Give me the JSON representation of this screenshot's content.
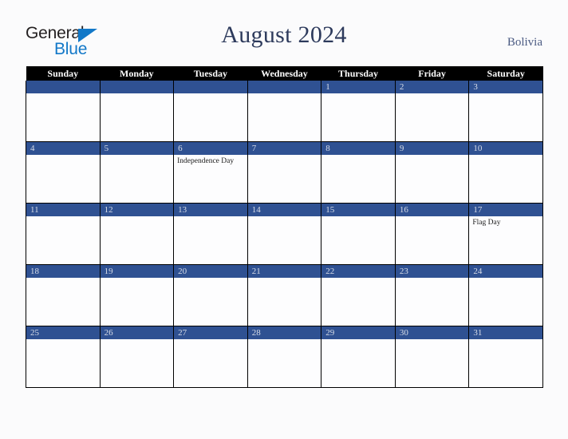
{
  "brand": {
    "name_part1": "General",
    "name_part2": "Blue",
    "triangle_color": "#1278c8",
    "text_color": "#231f20"
  },
  "header": {
    "title": "August 2024",
    "region": "Bolivia",
    "title_color": "#2d3a5c"
  },
  "calendar": {
    "weekday_headers": [
      "Sunday",
      "Monday",
      "Tuesday",
      "Wednesday",
      "Thursday",
      "Friday",
      "Saturday"
    ],
    "header_bg": "#000000",
    "daybar_bg": "#2f5192",
    "daybar_text_color": "#d8dde8",
    "cell_bg": "#fdfdfe",
    "weeks": [
      [
        {
          "date": "",
          "event": ""
        },
        {
          "date": "",
          "event": ""
        },
        {
          "date": "",
          "event": ""
        },
        {
          "date": "",
          "event": ""
        },
        {
          "date": "1",
          "event": ""
        },
        {
          "date": "2",
          "event": ""
        },
        {
          "date": "3",
          "event": ""
        }
      ],
      [
        {
          "date": "4",
          "event": ""
        },
        {
          "date": "5",
          "event": ""
        },
        {
          "date": "6",
          "event": "Independence Day"
        },
        {
          "date": "7",
          "event": ""
        },
        {
          "date": "8",
          "event": ""
        },
        {
          "date": "9",
          "event": ""
        },
        {
          "date": "10",
          "event": ""
        }
      ],
      [
        {
          "date": "11",
          "event": ""
        },
        {
          "date": "12",
          "event": ""
        },
        {
          "date": "13",
          "event": ""
        },
        {
          "date": "14",
          "event": ""
        },
        {
          "date": "15",
          "event": ""
        },
        {
          "date": "16",
          "event": ""
        },
        {
          "date": "17",
          "event": "Flag Day"
        }
      ],
      [
        {
          "date": "18",
          "event": ""
        },
        {
          "date": "19",
          "event": ""
        },
        {
          "date": "20",
          "event": ""
        },
        {
          "date": "21",
          "event": ""
        },
        {
          "date": "22",
          "event": ""
        },
        {
          "date": "23",
          "event": ""
        },
        {
          "date": "24",
          "event": ""
        }
      ],
      [
        {
          "date": "25",
          "event": ""
        },
        {
          "date": "26",
          "event": ""
        },
        {
          "date": "27",
          "event": ""
        },
        {
          "date": "28",
          "event": ""
        },
        {
          "date": "29",
          "event": ""
        },
        {
          "date": "30",
          "event": ""
        },
        {
          "date": "31",
          "event": ""
        }
      ]
    ]
  }
}
